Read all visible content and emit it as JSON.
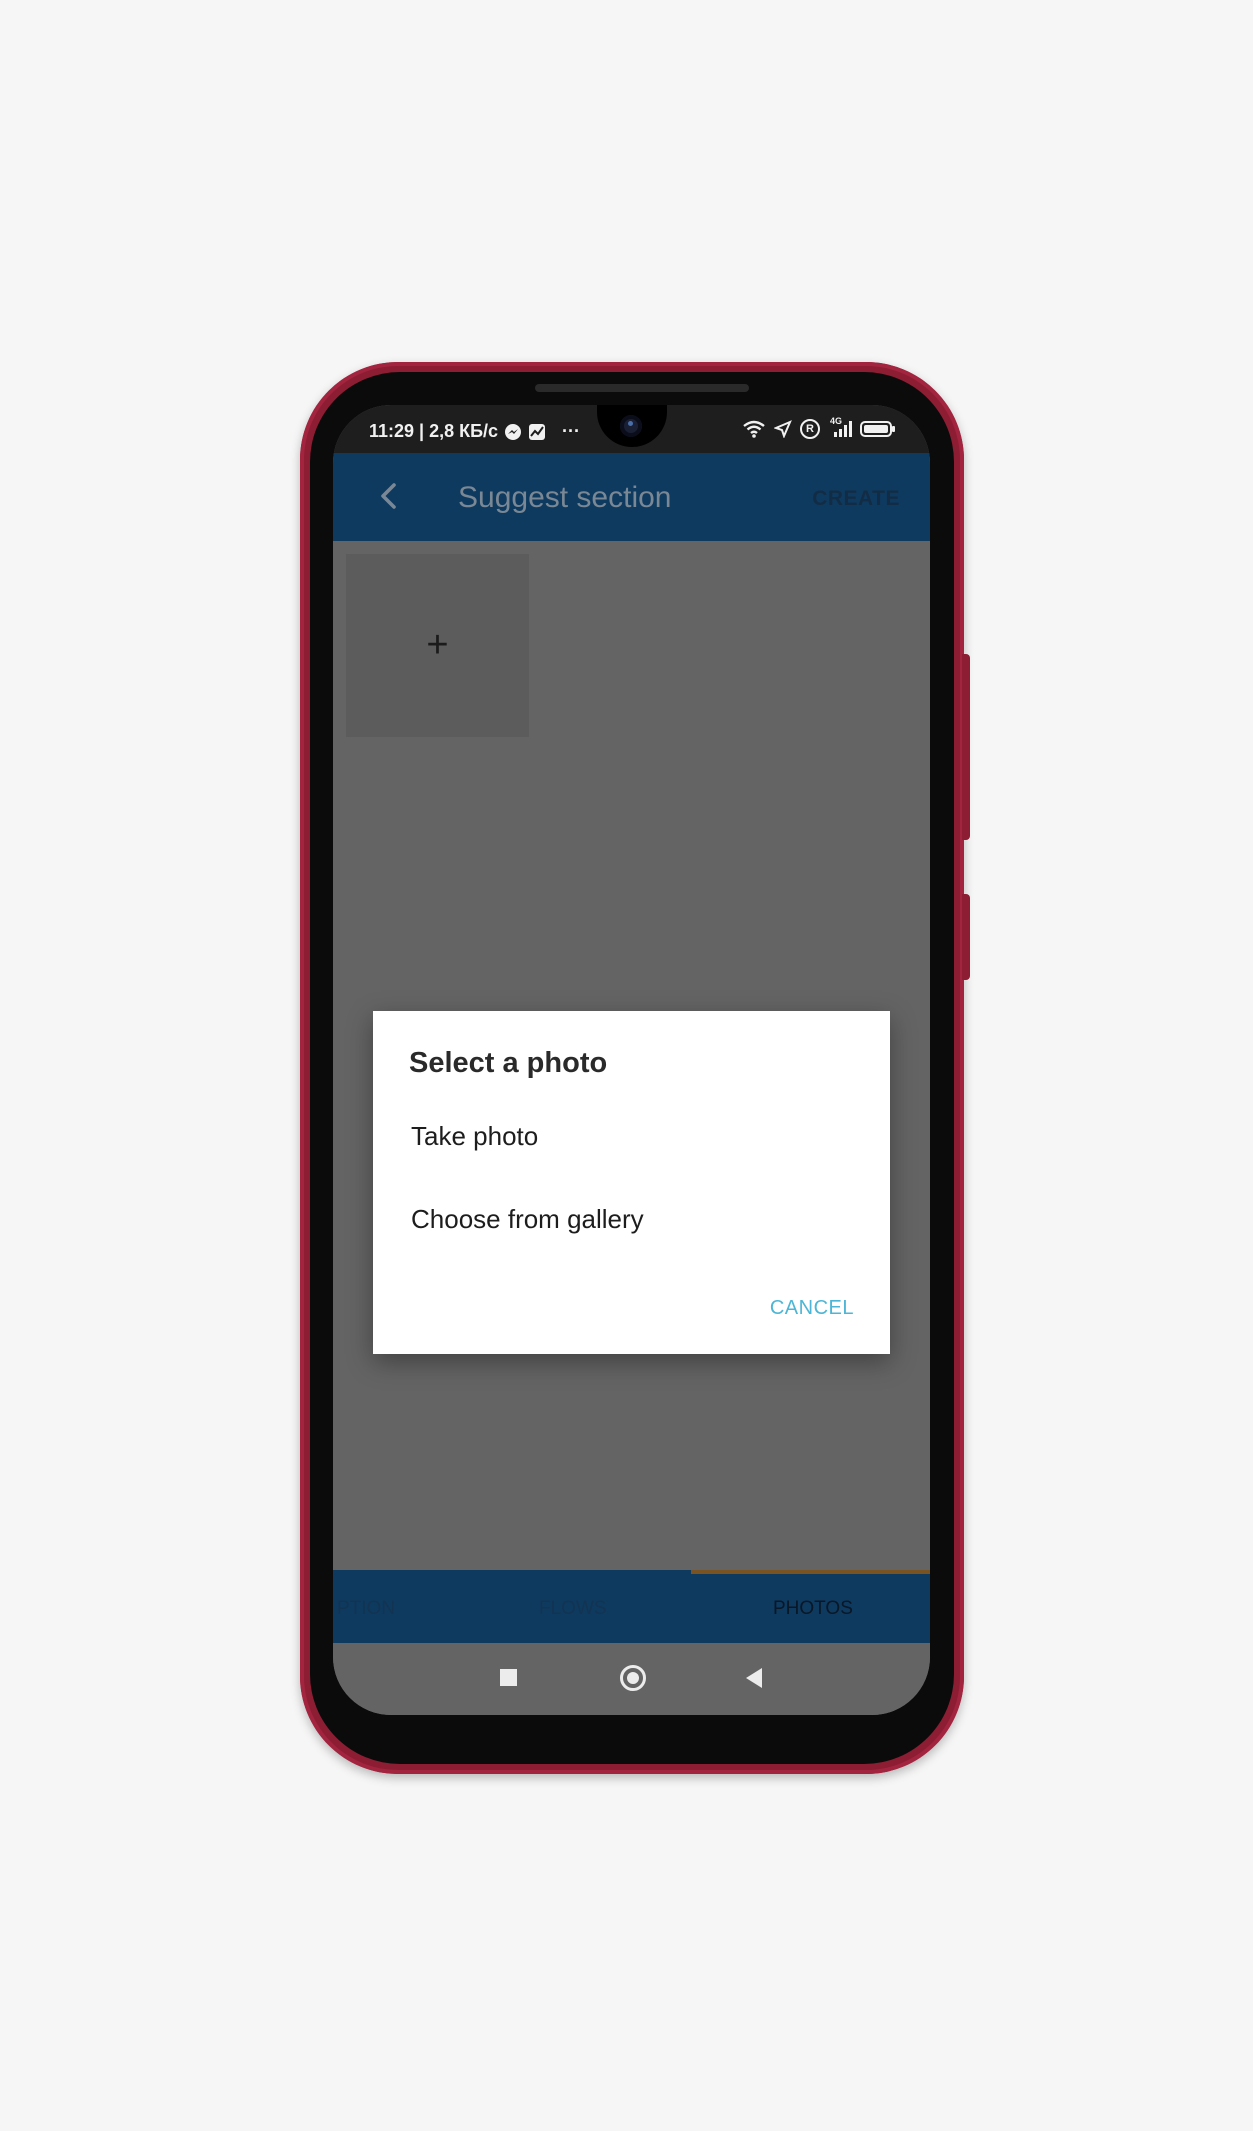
{
  "colors": {
    "background": "#f6f6f6",
    "phone_frame": "#8d1d33",
    "appbar": "#0e3a5f",
    "scrim_content": "#646464",
    "accent": "#4db6d6",
    "tab_indicator": "#7a5322"
  },
  "statusbar": {
    "time_speed": "11:29 | 2,8 КБ/с",
    "overflow": "···",
    "network": "4G",
    "icons": [
      "messenger-icon",
      "chart-icon",
      "wifi-icon",
      "location-icon",
      "roaming-r-icon",
      "signal-icon",
      "battery-icon"
    ],
    "roaming": "R"
  },
  "appbar": {
    "back_icon": "chevron-left-icon",
    "title": "Suggest section",
    "create_label": "CREATE"
  },
  "content": {
    "add_photo_label": "+"
  },
  "tabs": [
    {
      "label": "PTION",
      "active": false
    },
    {
      "label": "FLOWS",
      "active": false
    },
    {
      "label": "PHOTOS",
      "active": true
    }
  ],
  "dialog": {
    "title": "Select a photo",
    "options": [
      "Take photo",
      "Choose from gallery"
    ],
    "cancel_label": "CANCEL"
  },
  "navbar": {
    "icons": [
      "recents-square-icon",
      "home-circle-icon",
      "back-triangle-icon"
    ]
  }
}
